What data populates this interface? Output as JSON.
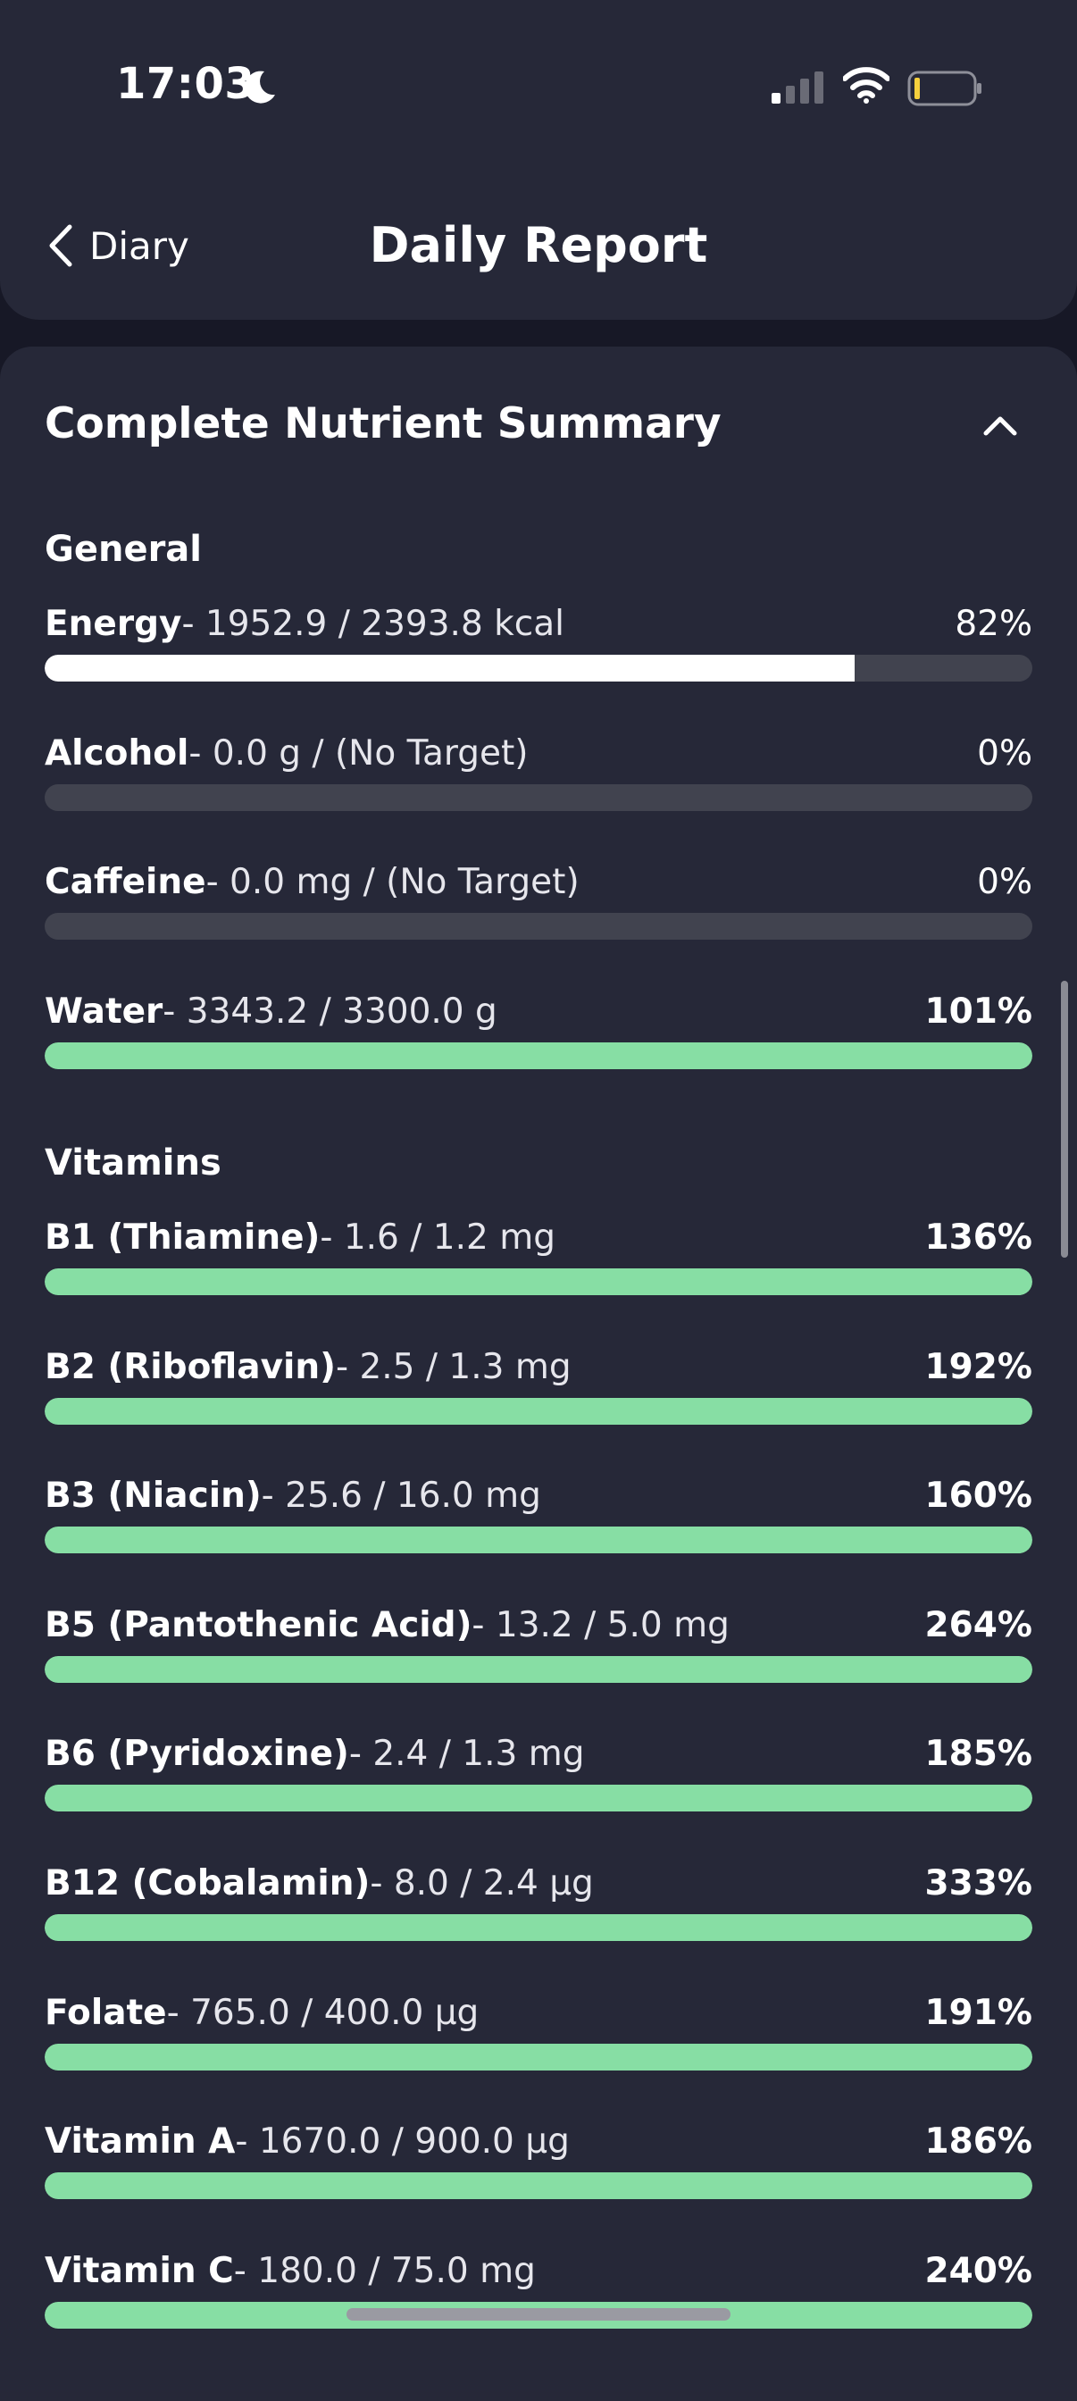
{
  "status_bar": {
    "time": "17:03"
  },
  "nav": {
    "back_label": "Diary",
    "title": "Daily Report"
  },
  "summary": {
    "title": "Complete Nutrient Summary"
  },
  "groups": [
    {
      "title": "General",
      "rows": [
        {
          "name": "Energy",
          "amount": "- 1952.9 / 2393.8 kcal",
          "percent": "82%",
          "fill_fraction": 0.82,
          "status": "partial"
        },
        {
          "name": "Alcohol",
          "amount": "- 0.0 g / (No Target)",
          "percent": "0%",
          "fill_fraction": 0,
          "status": "none"
        },
        {
          "name": "Caffeine",
          "amount": "- 0.0 mg / (No Target)",
          "percent": "0%",
          "fill_fraction": 0,
          "status": "none"
        },
        {
          "name": "Water",
          "amount": "- 3343.2 / 3300.0 g",
          "percent": "101%",
          "fill_fraction": 1,
          "status": "met"
        }
      ]
    },
    {
      "title": "Vitamins",
      "rows": [
        {
          "name": "B1 (Thiamine)",
          "amount": "- 1.6 / 1.2 mg",
          "percent": "136%",
          "fill_fraction": 1,
          "status": "met"
        },
        {
          "name": "B2 (Riboflavin)",
          "amount": "- 2.5 / 1.3 mg",
          "percent": "192%",
          "fill_fraction": 1,
          "status": "met"
        },
        {
          "name": "B3 (Niacin)",
          "amount": "- 25.6 / 16.0 mg",
          "percent": "160%",
          "fill_fraction": 1,
          "status": "met"
        },
        {
          "name": "B5 (Pantothenic Acid)",
          "amount": "- 13.2 / 5.0 mg",
          "percent": "264%",
          "fill_fraction": 1,
          "status": "met"
        },
        {
          "name": "B6 (Pyridoxine)",
          "amount": "- 2.4 / 1.3 mg",
          "percent": "185%",
          "fill_fraction": 1,
          "status": "met"
        },
        {
          "name": "B12 (Cobalamin)",
          "amount": "- 8.0 / 2.4 µg",
          "percent": "333%",
          "fill_fraction": 1,
          "status": "met"
        },
        {
          "name": "Folate",
          "amount": "- 765.0 / 400.0 µg",
          "percent": "191%",
          "fill_fraction": 1,
          "status": "met"
        },
        {
          "name": "Vitamin A",
          "amount": "- 1670.0 / 900.0 µg",
          "percent": "186%",
          "fill_fraction": 1,
          "status": "met"
        },
        {
          "name": "Vitamin C",
          "amount": "- 180.0 / 75.0 mg",
          "percent": "240%",
          "fill_fraction": 1,
          "status": "met"
        }
      ]
    }
  ],
  "colors": {
    "background": "#171826",
    "card": "#262838",
    "track": "#41434f",
    "partial_fill": "#ffffff",
    "met_fill": "#87dea4",
    "battery_low": "#f5cf3d"
  }
}
